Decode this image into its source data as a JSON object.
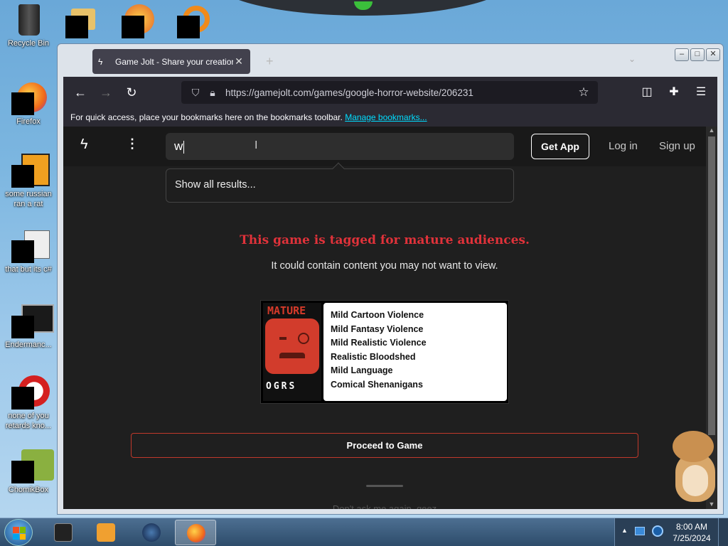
{
  "desktop": {
    "icons": [
      {
        "label": "Recycle Bin"
      },
      {
        "label": "Firefox"
      },
      {
        "label": "some russian ran a rat"
      },
      {
        "label": "that but its c#"
      },
      {
        "label": "Endermanc..."
      },
      {
        "label": "none of you retards kno..."
      },
      {
        "label": "ChomikBox"
      }
    ]
  },
  "browser": {
    "tab_title": "Game Jolt - Share your creations",
    "new_tab_glyph": "+",
    "url": "https://gamejolt.com/games/google-horror-website/206231",
    "bookmarks_hint": "For quick access, place your bookmarks here on the bookmarks toolbar.",
    "manage_bookmarks": "Manage bookmarks...",
    "icons": {
      "back": "back-arrow-icon",
      "forward": "forward-arrow-icon",
      "reload": "reload-icon",
      "shield": "shield-icon",
      "lock": "lock-icon",
      "star": "star-icon",
      "pocket": "pocket-icon",
      "extensions": "extensions-icon",
      "menu": "hamburger-menu-icon"
    }
  },
  "site": {
    "search_value": "w",
    "get_app": "Get App",
    "log_in": "Log in",
    "sign_up": "Sign up",
    "search_dropdown": "Show all results..."
  },
  "mature": {
    "title": "This game is tagged for mature audiences.",
    "subtitle": "It could contain content you may not want to view.",
    "badge_top": "MATURE",
    "badge_bottom": "OGRS",
    "descriptors": [
      "Mild Cartoon Violence",
      "Mild Fantasy Violence",
      "Mild Realistic Violence",
      "Realistic Bloodshed",
      "Mild Language",
      "Comical Shenanigans"
    ],
    "proceed": "Proceed to Game",
    "dont_ask": "Don't ask me again, geez"
  },
  "taskbar": {
    "time": "8:00 AM",
    "date": "7/25/2024"
  },
  "colors": {
    "accent_red": "#e0323a",
    "link_cyan": "#00ddff",
    "page_bg": "#1f1f1f",
    "browser_chrome": "#2b2a33"
  }
}
